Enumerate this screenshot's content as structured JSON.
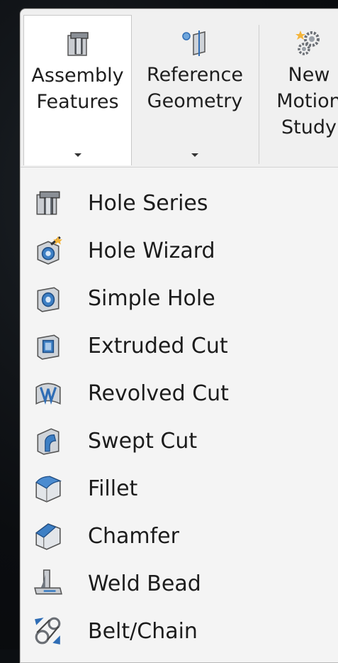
{
  "ribbon": {
    "buttons": [
      {
        "line1": "Assembly",
        "line2": "Features",
        "icon": "assembly-features-icon",
        "has_dropdown": true
      },
      {
        "line1": "Reference",
        "line2": "Geometry",
        "icon": "reference-geometry-icon",
        "has_dropdown": true
      },
      {
        "line1": "New",
        "line2": "Motion",
        "line3": "Study",
        "icon": "motion-study-icon",
        "has_dropdown": false
      }
    ]
  },
  "menu": {
    "items": [
      {
        "label": "Hole Series",
        "icon": "hole-series-icon"
      },
      {
        "label": "Hole Wizard",
        "icon": "hole-wizard-icon"
      },
      {
        "label": "Simple Hole",
        "icon": "simple-hole-icon"
      },
      {
        "label": "Extruded Cut",
        "icon": "extruded-cut-icon"
      },
      {
        "label": "Revolved Cut",
        "icon": "revolved-cut-icon"
      },
      {
        "label": "Swept Cut",
        "icon": "swept-cut-icon"
      },
      {
        "label": "Fillet",
        "icon": "fillet-icon"
      },
      {
        "label": "Chamfer",
        "icon": "chamfer-icon"
      },
      {
        "label": "Weld Bead",
        "icon": "weld-bead-icon"
      },
      {
        "label": "Belt/Chain",
        "icon": "belt-chain-icon"
      }
    ]
  },
  "colors": {
    "icon_blue": "#2f6db5",
    "icon_gray": "#8a8f96",
    "text": "#1c1c1c"
  }
}
